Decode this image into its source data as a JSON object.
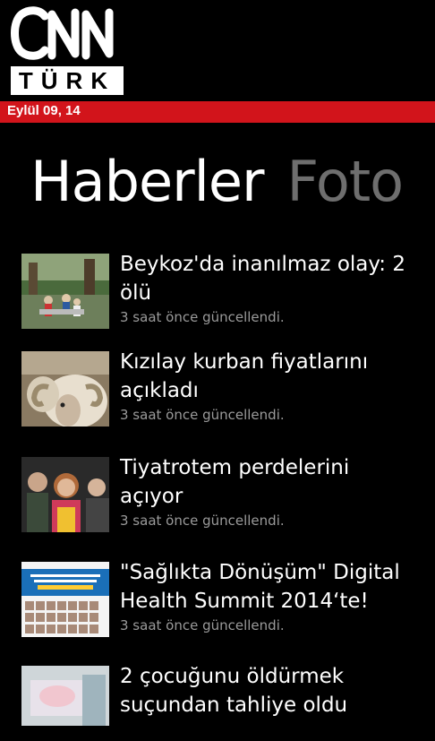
{
  "app": {
    "logo_line1": "CNN",
    "logo_line2": "TÜRK",
    "date": "Eylül 09, 14",
    "brand_color": "#d2141b"
  },
  "pivot": {
    "active": "Haberler",
    "inactive": "Foto"
  },
  "news": [
    {
      "title": "Beykoz'da inanılmaz olay: 2 ölü",
      "meta": "3 saat önce güncellendi.",
      "thumb_icon": "park-crowd-photo"
    },
    {
      "title": "Kızılay kurban fiyatlarını açıkladı",
      "meta": "3 saat önce güncellendi.",
      "thumb_icon": "sheep-photo"
    },
    {
      "title": "Tiyatrotem perdelerini açıyor",
      "meta": "3 saat önce güncellendi.",
      "thumb_icon": "actors-photo"
    },
    {
      "title": "\"Sağlıkta Dönüşüm\" Digital Health Summit 2014‘te!",
      "meta": "3 saat önce güncellendi.",
      "thumb_icon": "summit-poster-photo"
    },
    {
      "title": "2 çocuğunu öldürmek suçundan tahliye oldu",
      "meta": "",
      "thumb_icon": "hospital-photo"
    }
  ]
}
